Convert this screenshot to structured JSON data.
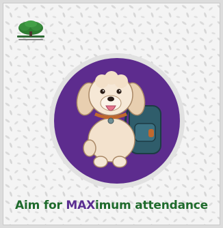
{
  "poster": {
    "headline_prefix": "Aim for ",
    "headline_emphasis": "MAX",
    "headline_suffix": "imum attendance",
    "logo_icon": "school-tree-logo",
    "mascot_icon": "dog-with-backpack-icon"
  },
  "colors": {
    "headline_green": "#1f6b2c",
    "headline_purple": "#5b2e91",
    "medallion_purple": "#5d2c8e",
    "medallion_ring": "#e1e1e1",
    "background": "#f4f4f4",
    "leaf_pattern": "#d7d7d7"
  }
}
